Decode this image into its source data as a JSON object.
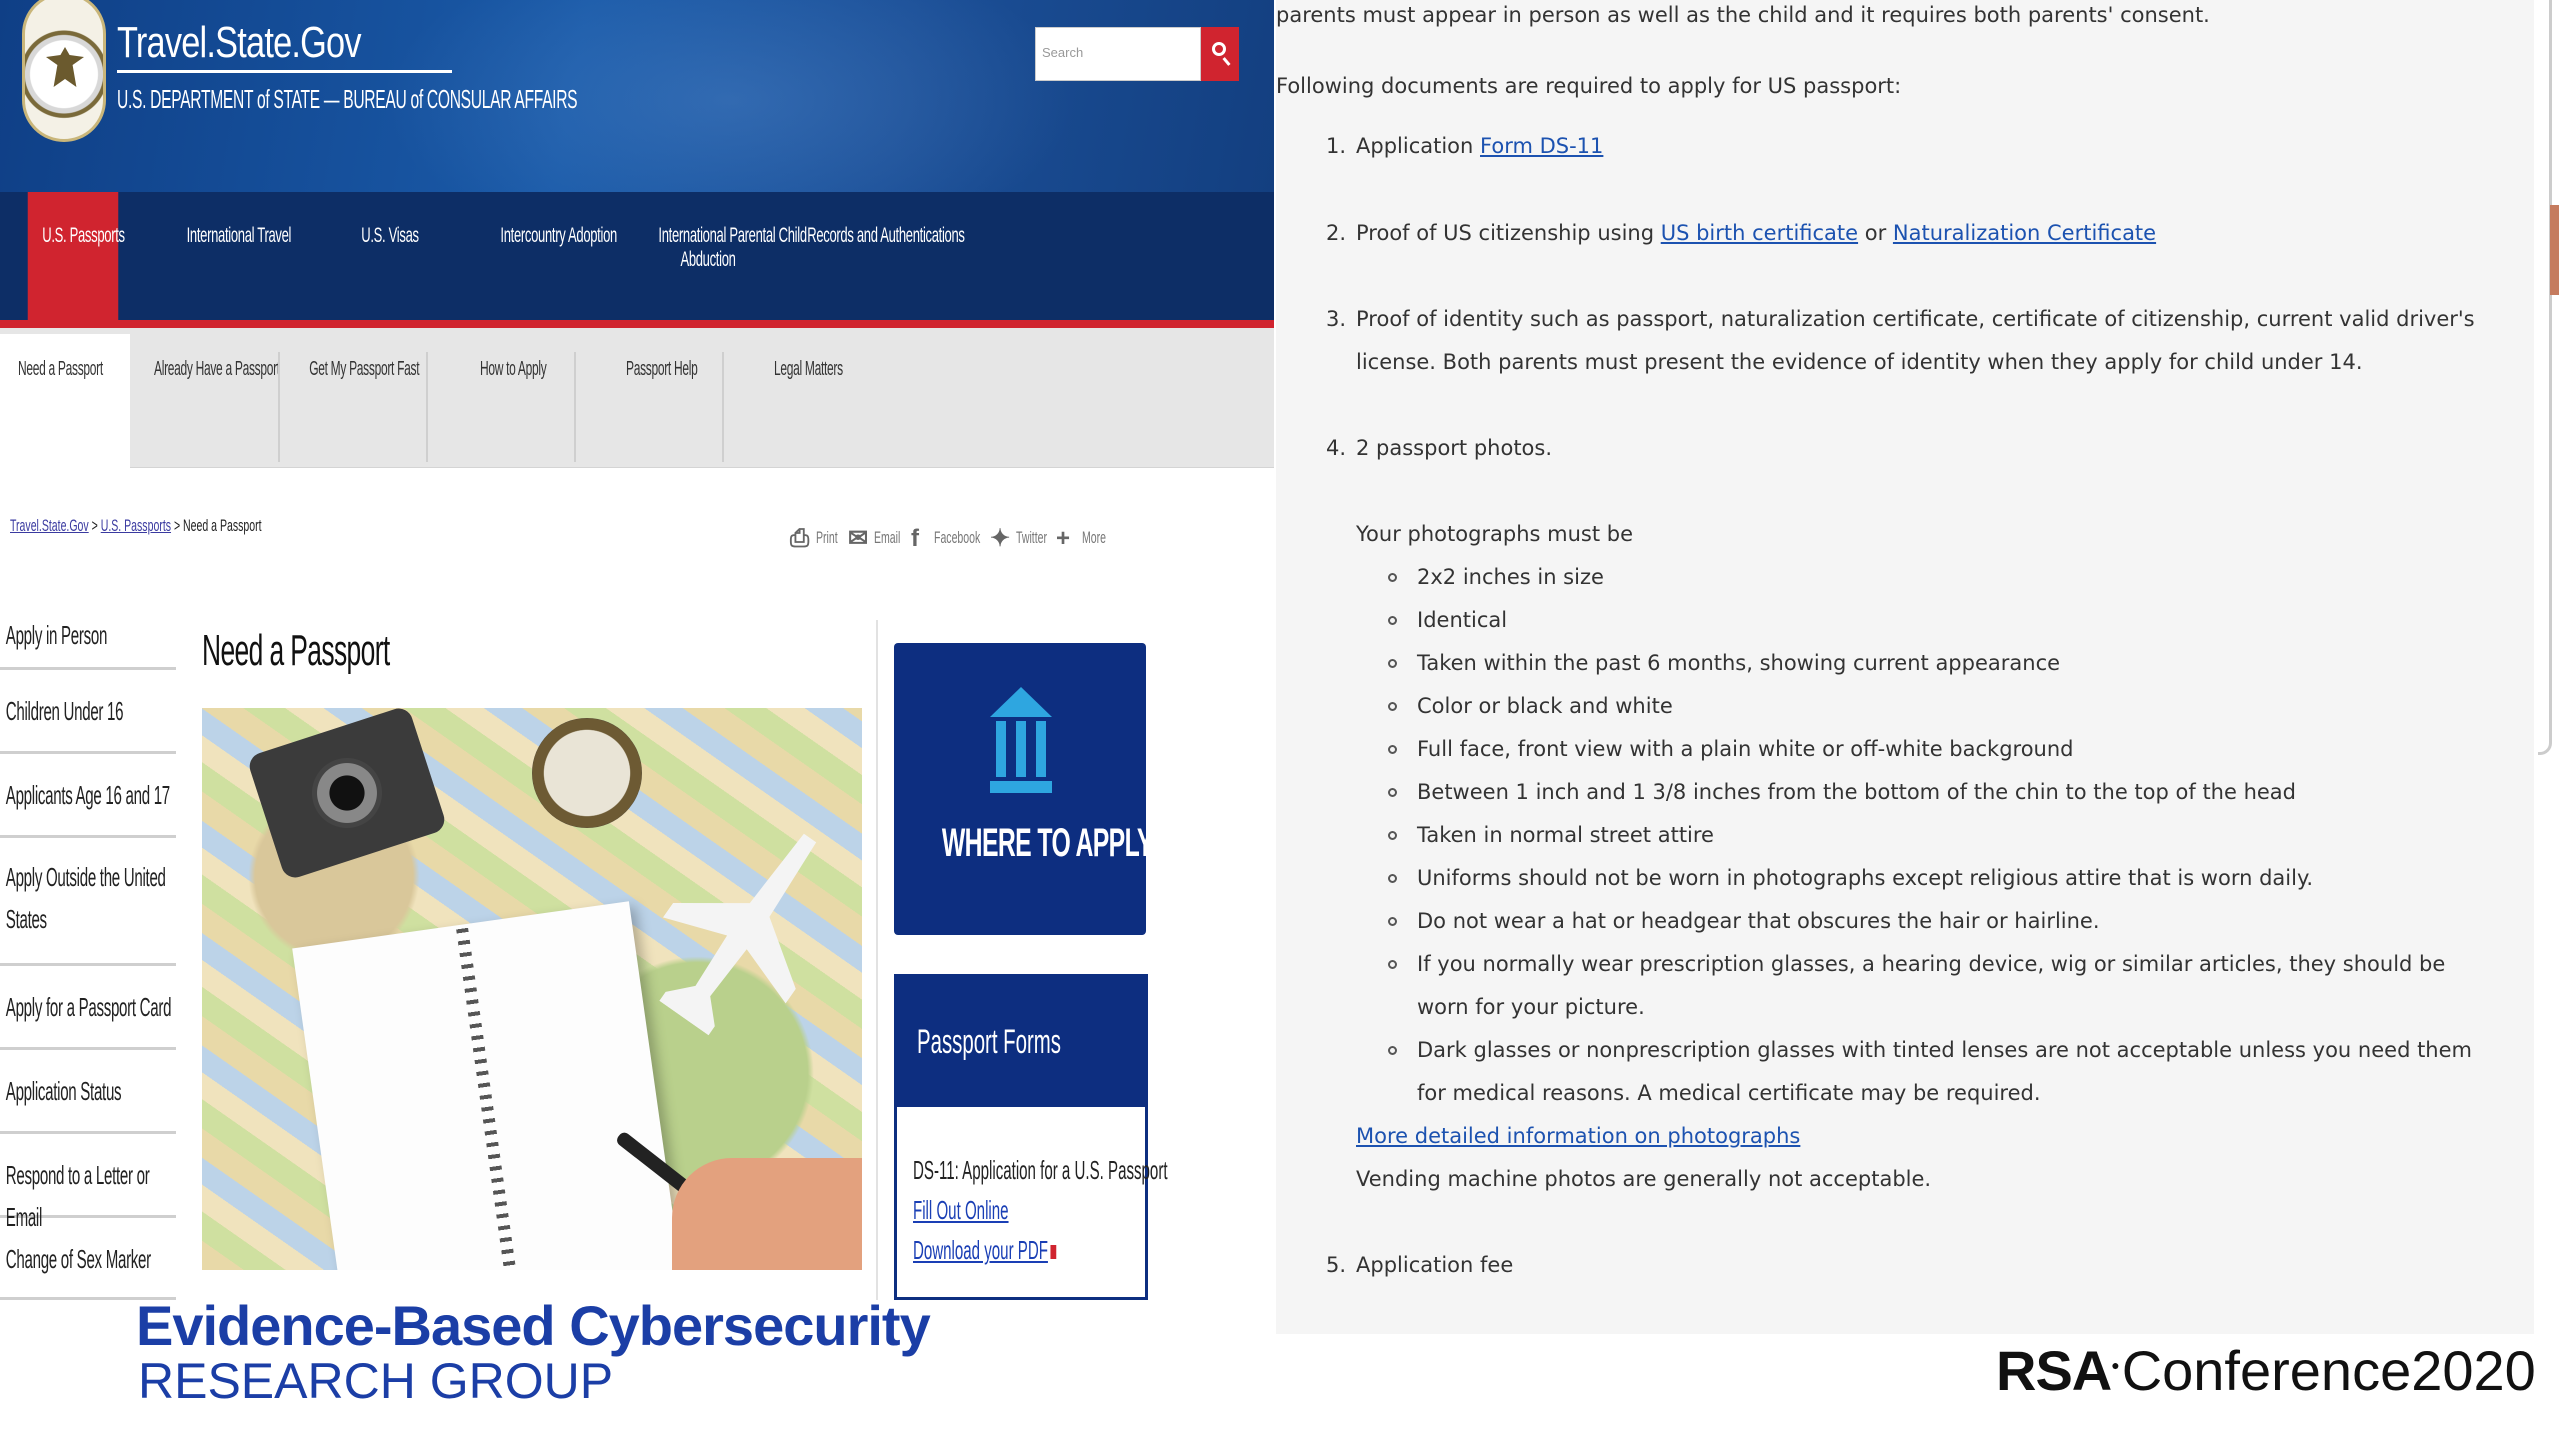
{
  "site": {
    "title": "Travel.State.Gov",
    "subtitle": "U.S. DEPARTMENT of STATE — BUREAU of CONSULAR AFFAIRS",
    "search_placeholder": "Search"
  },
  "mainnav": [
    {
      "label": "U.S. Passports",
      "active": true
    },
    {
      "label": "International Travel"
    },
    {
      "label": "U.S. Visas"
    },
    {
      "label": "Intercountry Adoption"
    },
    {
      "label": "International Parental Child",
      "label2": "Abduction"
    },
    {
      "label": "Records and Authentications"
    }
  ],
  "subnav": [
    {
      "label": "Need a Passport",
      "active": true
    },
    {
      "label": "Already Have a Passport"
    },
    {
      "label": "Get My Passport Fast"
    },
    {
      "label": "How to Apply"
    },
    {
      "label": "Passport Help"
    },
    {
      "label": "Legal Matters"
    }
  ],
  "breadcrumb": {
    "home": "Travel.State.Gov",
    "sep": ">",
    "section": "U.S. Passports",
    "current": "Need a Passport"
  },
  "share": {
    "print": "Print",
    "email": "Email",
    "facebook": "Facebook",
    "twitter": "Twitter",
    "more": "More"
  },
  "sidebar": [
    {
      "label": "Apply in Person"
    },
    {
      "label": "Children Under 16"
    },
    {
      "label": "Applicants Age 16 and 17"
    },
    {
      "label": "Apply Outside the United",
      "label2": "States"
    },
    {
      "label": "Apply for a Passport Card"
    },
    {
      "label": "Application Status"
    },
    {
      "label": "Respond to a Letter or Email"
    },
    {
      "label": "Change of Sex Marker"
    }
  ],
  "page_title": "Need a Passport",
  "where_to_apply": "WHERE TO APPLY",
  "forms": {
    "title": "Passport Forms",
    "item": "DS-11: Application for a U.S. Passport",
    "fill_online": "Fill Out Online",
    "download": "Download your PDF"
  },
  "doc": {
    "top_line": "parents must appear in person as well as the child and it requires both parents' consent.",
    "intro": "Following documents are required to apply for US passport:",
    "item1_num": "1.",
    "item1_text": "Application ",
    "item1_link": "Form DS-11",
    "item2_num": "2.",
    "item2_text": "Proof of US citizenship using ",
    "item2_link1": "US birth certificate",
    "item2_or": " or ",
    "item2_link2": "Naturalization Certificate",
    "item3_num": "3.",
    "item3_line1": "Proof of identity such as passport, naturalization certificate, certificate of citizenship, current valid driver's",
    "item3_line2": "license. Both parents must present the evidence of identity when they apply for child under 14.",
    "item4_num": "4.",
    "item4_text": "2 passport photos.",
    "photos_intro": "Your photographs must be",
    "photo_rules": [
      "2x2 inches in size",
      "Identical",
      "Taken within the past 6 months, showing current appearance",
      "Color or black and white",
      "Full face, front view with a plain white or off-white background",
      "Between 1 inch and 1 3/8 inches from the bottom of the chin to the top of the head",
      "Taken in normal street attire",
      "Uniforms should not be worn in photographs except religious attire that is worn daily.",
      "Do not wear a hat or headgear that obscures the hair or hairline.",
      "If you normally wear prescription glasses, a hearing device, wig or similar articles, they should be",
      "Dark glasses or nonprescription glasses with tinted lenses are not acceptable unless you need them"
    ],
    "rule10_cont": "worn for your picture.",
    "rule11_cont": "for medical reasons. A medical certificate may be required.",
    "more_info_link": "More detailed information on photographs",
    "vending_note": "Vending machine photos are generally not acceptable.",
    "item5_num": "5.",
    "item5_text": "Application fee"
  },
  "branding": {
    "ebc_line1": "Evidence-Based Cybersecurity",
    "ebc_line2": "RESEARCH GROUP",
    "rsa_bold": "RSA",
    "rsa_rest": "Conference2020"
  }
}
